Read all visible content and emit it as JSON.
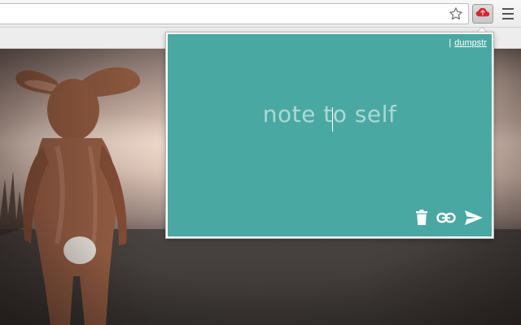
{
  "browser": {
    "address_value": "",
    "icons": [
      "bookmark-star-icon",
      "dumpstr-cloud-icon",
      "hamburger-menu-icon"
    ]
  },
  "popup": {
    "brand_separator": "|",
    "brand_link": "dumpstr",
    "note_placeholder": "note to self",
    "note_value": "",
    "background_color": "#4aa8a2",
    "actions": [
      "trash-icon",
      "link-icon",
      "send-icon"
    ]
  },
  "colors": {
    "accent": "#4aa8a2",
    "extension_icon": "#d9272e"
  }
}
